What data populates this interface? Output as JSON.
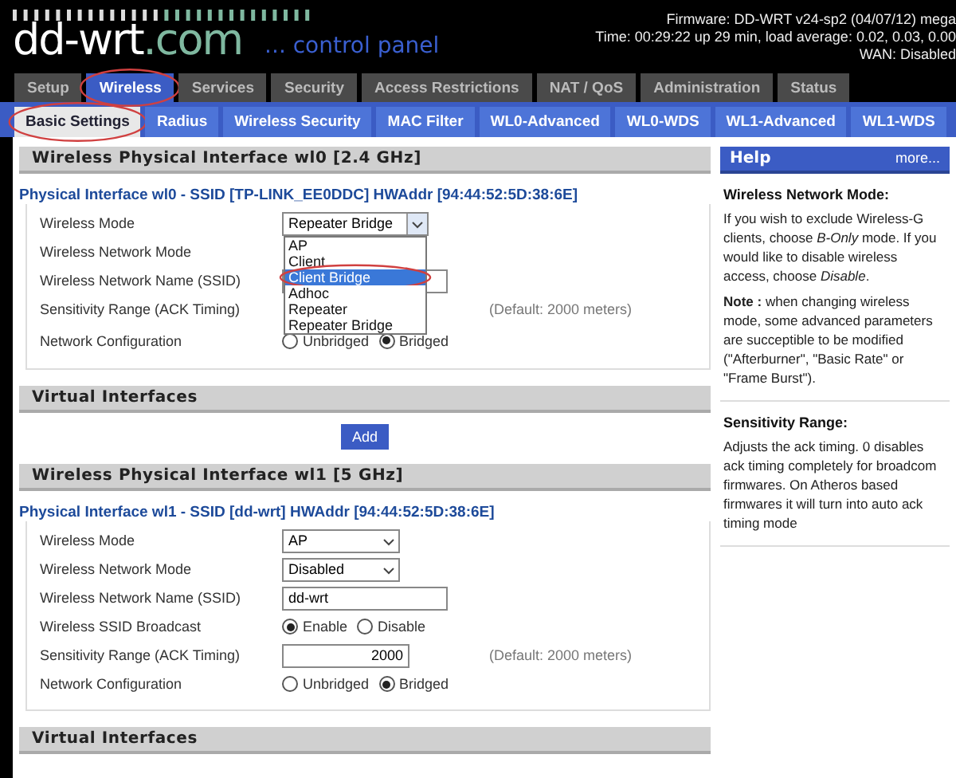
{
  "header": {
    "logo": {
      "name": "dd-wrt",
      "suffix": ".com"
    },
    "tagline": "... control panel",
    "info": [
      "Firmware: DD-WRT v24-sp2 (04/07/12) mega",
      "Time: 00:29:22 up 29 min, load average: 0.02, 0.03, 0.00",
      "WAN: Disabled"
    ]
  },
  "tabs": [
    {
      "label": "Setup",
      "selected": false,
      "annotated": false
    },
    {
      "label": "Wireless",
      "selected": true,
      "annotated": true
    },
    {
      "label": "Services",
      "selected": false,
      "annotated": false
    },
    {
      "label": "Security",
      "selected": false,
      "annotated": false
    },
    {
      "label": "Access Restrictions",
      "selected": false,
      "annotated": false
    },
    {
      "label": "NAT / QoS",
      "selected": false,
      "annotated": false
    },
    {
      "label": "Administration",
      "selected": false,
      "annotated": false
    },
    {
      "label": "Status",
      "selected": false,
      "annotated": false
    }
  ],
  "subtabs": [
    {
      "label": "Basic Settings",
      "selected": true,
      "annotated": true
    },
    {
      "label": "Radius",
      "selected": false,
      "annotated": false
    },
    {
      "label": "Wireless Security",
      "selected": false,
      "annotated": false
    },
    {
      "label": "MAC Filter",
      "selected": false,
      "annotated": false
    },
    {
      "label": "WL0-Advanced",
      "selected": false,
      "annotated": false
    },
    {
      "label": "WL0-WDS",
      "selected": false,
      "annotated": false
    },
    {
      "label": "WL1-Advanced",
      "selected": false,
      "annotated": false
    },
    {
      "label": "WL1-WDS",
      "selected": false,
      "annotated": false
    }
  ],
  "sections": [
    {
      "kind": "interface",
      "title": "Wireless Physical Interface wl0 [2.4 GHz]",
      "legend": "Physical Interface wl0 - SSID [TP-LINK_EE0DDC] HWAddr [94:44:52:5D:38:6E]",
      "rows": [
        {
          "label": "Wireless Mode",
          "control": {
            "kind": "select",
            "value": "Repeater Bridge",
            "open": true,
            "options": [
              {
                "label": "AP",
                "highlighted": false,
                "annotated": false
              },
              {
                "label": "Client",
                "highlighted": false,
                "annotated": false
              },
              {
                "label": "Client Bridge",
                "highlighted": true,
                "annotated": true
              },
              {
                "label": "Adhoc",
                "highlighted": false,
                "annotated": false
              },
              {
                "label": "Repeater",
                "highlighted": false,
                "annotated": false
              },
              {
                "label": "Repeater Bridge",
                "highlighted": false,
                "annotated": false
              }
            ]
          }
        },
        {
          "label": "Wireless Network Mode"
        },
        {
          "label": "Wireless Network Name (SSID)",
          "control": {
            "kind": "text"
          }
        },
        {
          "label": "Sensitivity Range (ACK Timing)",
          "note": "(Default: 2000 meters)"
        },
        {
          "label": "Network Configuration",
          "control": {
            "kind": "radio",
            "options": [
              {
                "label": "Unbridged",
                "selected": false
              },
              {
                "label": "Bridged",
                "selected": true
              }
            ]
          }
        }
      ]
    },
    {
      "kind": "virtual",
      "title": "Virtual Interfaces",
      "button": "Add"
    },
    {
      "kind": "interface",
      "title": "Wireless Physical Interface wl1 [5 GHz]",
      "legend": "Physical Interface wl1 - SSID [dd-wrt] HWAddr [94:44:52:5D:38:6E]",
      "rows": [
        {
          "label": "Wireless Mode",
          "control": {
            "kind": "select",
            "value": "AP",
            "open": false
          }
        },
        {
          "label": "Wireless Network Mode",
          "control": {
            "kind": "select",
            "value": "Disabled",
            "open": false
          }
        },
        {
          "label": "Wireless Network Name (SSID)",
          "control": {
            "kind": "text",
            "value": "dd-wrt"
          }
        },
        {
          "label": "Wireless SSID Broadcast",
          "control": {
            "kind": "radio",
            "options": [
              {
                "label": "Enable",
                "selected": true
              },
              {
                "label": "Disable",
                "selected": false
              }
            ]
          }
        },
        {
          "label": "Sensitivity Range (ACK Timing)",
          "control": {
            "kind": "number",
            "value": "2000"
          },
          "note": "(Default: 2000 meters)"
        },
        {
          "label": "Network Configuration",
          "control": {
            "kind": "radio",
            "options": [
              {
                "label": "Unbridged",
                "selected": false
              },
              {
                "label": "Bridged",
                "selected": true
              }
            ]
          }
        }
      ]
    },
    {
      "kind": "virtual",
      "title": "Virtual Interfaces"
    }
  ],
  "help": {
    "title": "Help",
    "more": "more...",
    "entries": [
      {
        "heading": "Wireless Network Mode:",
        "paragraphs": [
          "If you wish to exclude Wireless-G clients, choose *B-Only* mode. If you would like to disable wireless access, choose *Disable*.",
          "**Note :** when changing wireless mode, some advanced parameters are succeptible to be modified (\"Afterburner\", \"Basic Rate\" or \"Frame Burst\")."
        ]
      },
      {
        "heading": "Sensitivity Range:",
        "paragraphs": [
          "Adjusts the ack timing. 0 disables ack timing completely for broadcom firmwares. On Atheros based firmwares it will turn into auto ack timing mode"
        ]
      }
    ]
  }
}
